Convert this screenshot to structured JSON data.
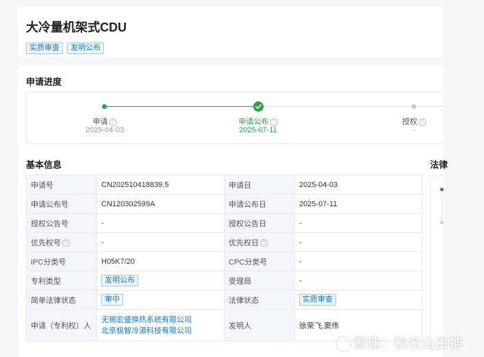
{
  "header": {
    "title": "大冷量机架式CDU",
    "tags": [
      "实质审查",
      "发明公布"
    ]
  },
  "progress": {
    "section_title": "申请进度",
    "steps": [
      {
        "label": "申请",
        "date": "2025-04-03",
        "state": "done"
      },
      {
        "label": "申请公布",
        "date": "2025-07-11",
        "state": "current"
      },
      {
        "label": "授权",
        "date": "-",
        "state": "pending"
      }
    ]
  },
  "basic_info": {
    "section_title": "基本信息",
    "rows": [
      {
        "l1": "申请号",
        "v1": "CN202510418839.5",
        "l2": "申请日",
        "v2": "2025-04-03"
      },
      {
        "l1": "申请公布号",
        "v1": "CN120302599A",
        "l2": "申请公布日",
        "v2": "2025-07-11"
      },
      {
        "l1": "授权公告号",
        "v1": "-",
        "l2": "授权公告日",
        "v2": "-"
      },
      {
        "l1": "优先权号",
        "v1": "-",
        "l2": "优先权日",
        "v2": "-"
      },
      {
        "l1": "IPC分类号",
        "v1": "H05K7/20",
        "l2": "CPC分类号",
        "v2": "-"
      },
      {
        "l1": "专利类型",
        "v1": "发明公布",
        "l2": "受理局",
        "v2": "-"
      },
      {
        "l1": "简单法律状态",
        "v1": "审中",
        "l2": "法律状态",
        "v2": "实质审查"
      },
      {
        "l1": "申请（专利权）人",
        "v1": [
          "无锡宏盛换热系统有限公司",
          "北京极智冷源科技有限公司"
        ],
        "l2": "发明人",
        "v2": "徐荣飞,窦伟"
      }
    ]
  },
  "side_panel": {
    "title": "法律"
  },
  "watermark": {
    "text": "雪球：秋名山白神"
  },
  "colors": {
    "accent": "#1677d9",
    "success": "#2ba24a",
    "label_bg": "#f2f6fb"
  }
}
